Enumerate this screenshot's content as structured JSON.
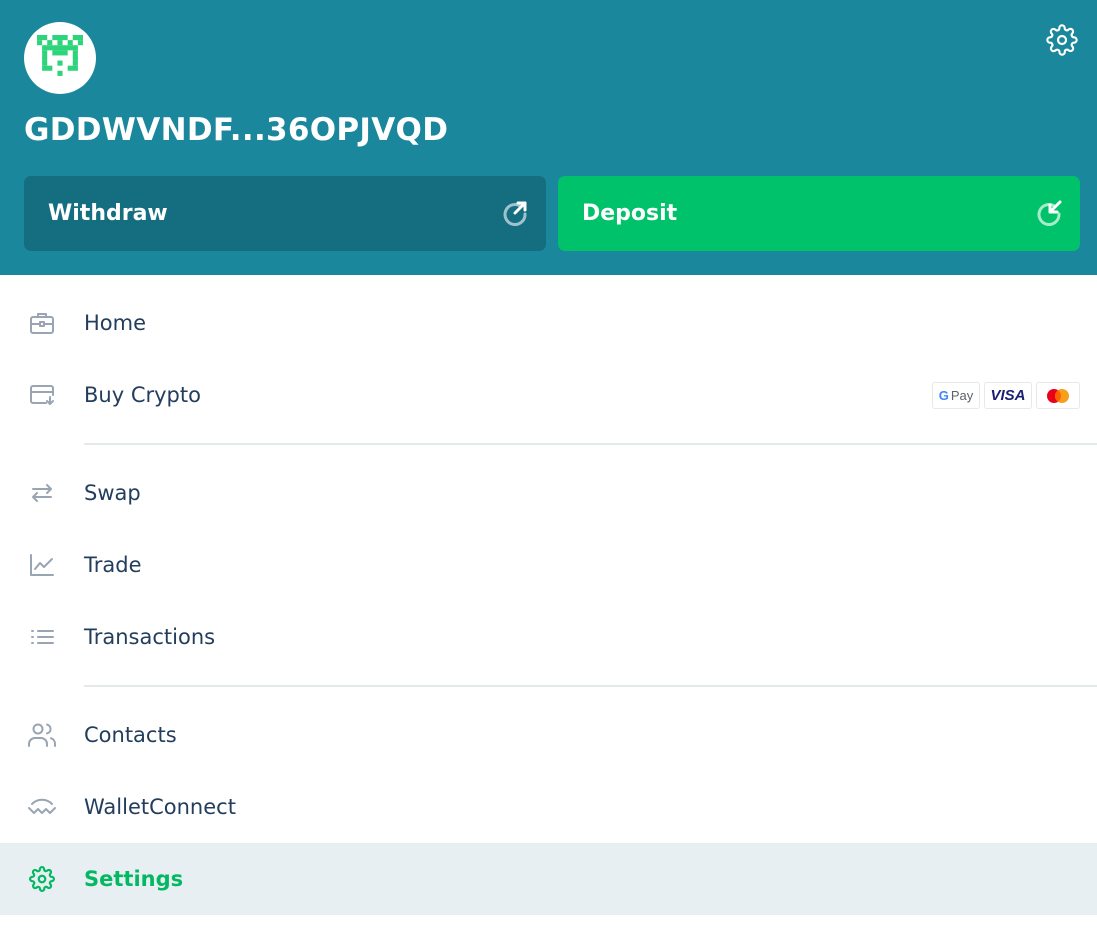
{
  "header": {
    "account_id": "GDDWVNDF...36OPJVQD",
    "avatar_icon": "identicon",
    "settings_icon": "gear-icon",
    "background_color": "#1a879c"
  },
  "actions": {
    "withdraw": {
      "label": "Withdraw",
      "icon": "arrow-up-right-icon",
      "color": "#156d80"
    },
    "deposit": {
      "label": "Deposit",
      "icon": "arrow-down-left-icon",
      "color": "#00c26a"
    }
  },
  "menu": {
    "items": [
      {
        "label": "Home",
        "icon": "briefcase-icon"
      },
      {
        "label": "Buy Crypto",
        "icon": "card-download-icon",
        "badges": [
          "G Pay",
          "VISA",
          "mastercard"
        ]
      },
      {
        "label": "Swap",
        "icon": "swap-arrows-icon"
      },
      {
        "label": "Trade",
        "icon": "line-chart-icon"
      },
      {
        "label": "Transactions",
        "icon": "list-icon"
      },
      {
        "label": "Contacts",
        "icon": "users-icon"
      },
      {
        "label": "WalletConnect",
        "icon": "walletconnect-icon"
      },
      {
        "label": "Settings",
        "icon": "gear-icon",
        "active": true
      }
    ],
    "accent_color": "#04b863"
  },
  "payment_badges": {
    "gpay_g": "G",
    "gpay_text": "Pay",
    "visa": "VISA"
  }
}
